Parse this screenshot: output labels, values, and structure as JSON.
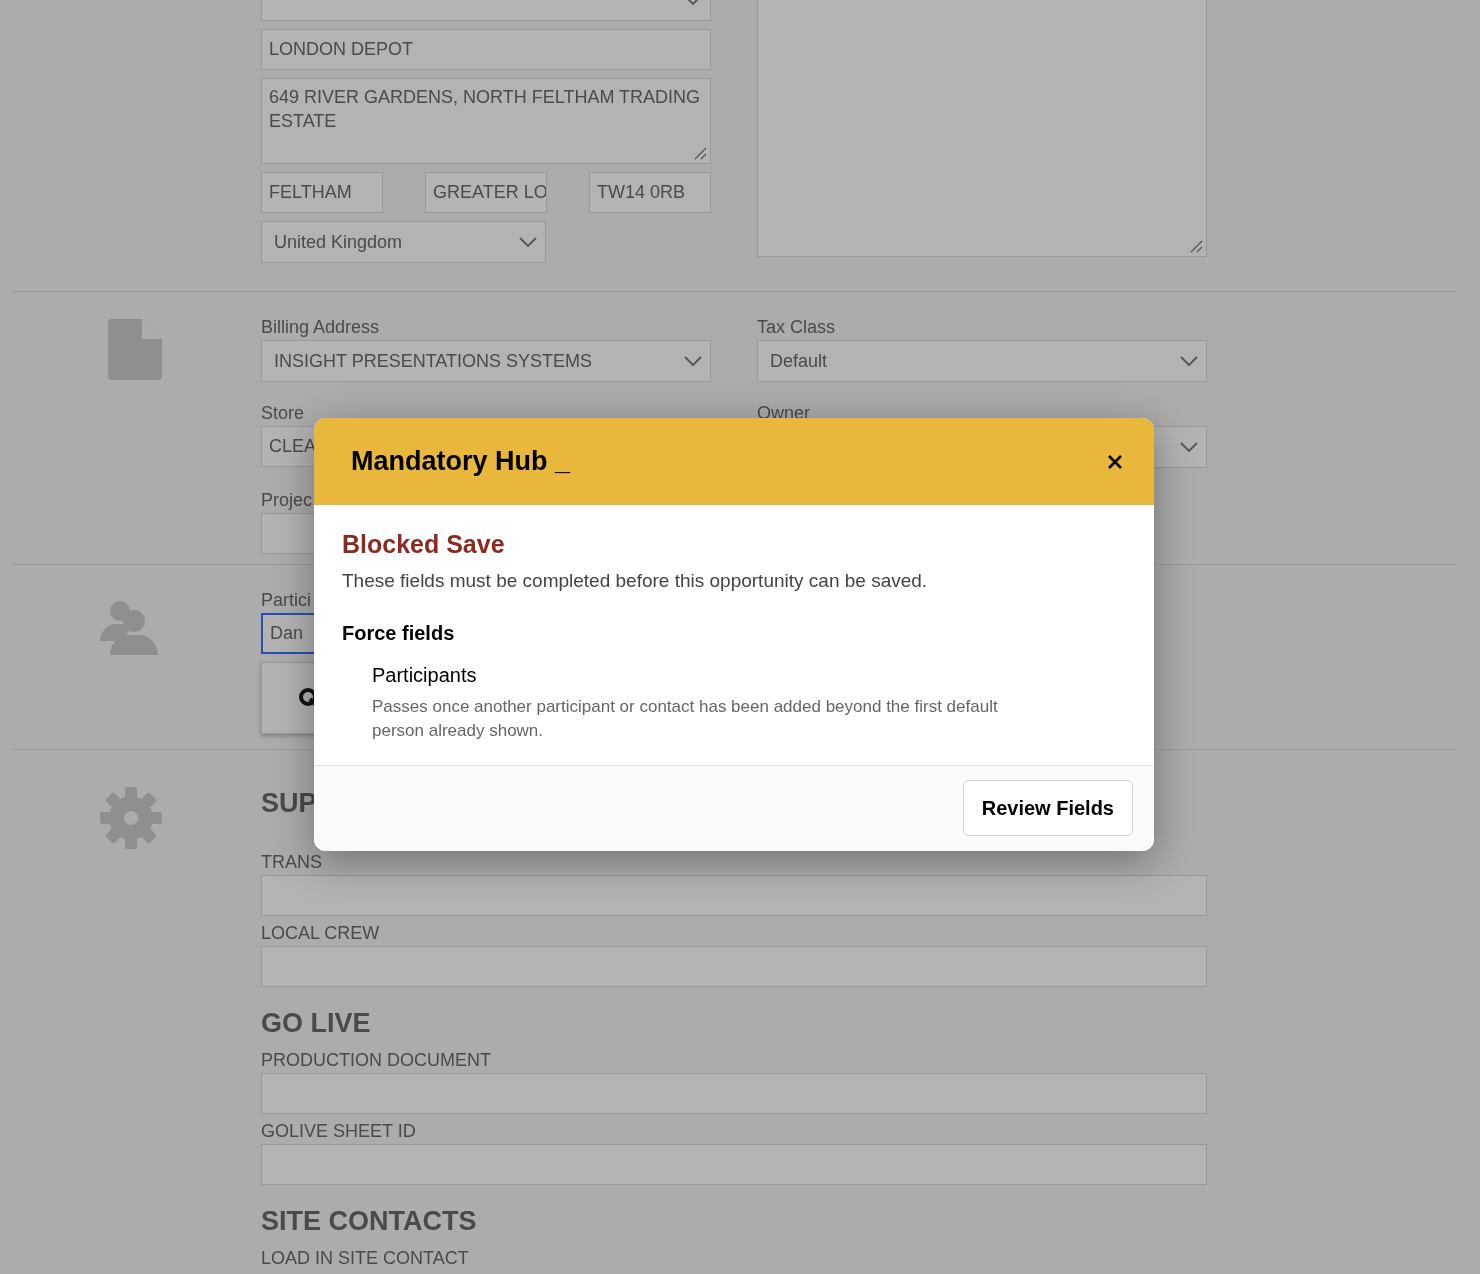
{
  "address": {
    "company": "LONDON DEPOT",
    "street": "649 RIVER GARDENS, NORTH FELTHAM TRADING ESTATE",
    "city": "FELTHAM",
    "county": "GREATER LO",
    "postcode": "TW14 0RB",
    "country": "United Kingdom"
  },
  "billing": {
    "fields": [
      {
        "label": "Billing Address",
        "value": "INSIGHT PRESENTATIONS SYSTEMS",
        "kind": "select"
      },
      {
        "label": "Tax Class",
        "value": "Default",
        "kind": "select"
      },
      {
        "label": "Store",
        "value": "CLEA",
        "kind": "input"
      },
      {
        "label": "Owner",
        "kind": "select"
      },
      {
        "label": "Projec",
        "kind": "input"
      }
    ]
  },
  "participants": {
    "label": "Partici",
    "value": "Dan",
    "focused": true
  },
  "custom_fields": {
    "sections": [
      {
        "heading": "SUP",
        "fields": [
          {
            "label": "TRANS"
          },
          {
            "label": "LOCAL CREW"
          }
        ]
      },
      {
        "heading": "GO LIVE",
        "fields": [
          {
            "label": "PRODUCTION DOCUMENT"
          },
          {
            "label": "GOLIVE SHEET ID"
          }
        ]
      },
      {
        "heading": "SITE CONTACTS",
        "fields": [
          {
            "label": "LOAD IN SITE CONTACT"
          }
        ]
      }
    ]
  },
  "modal": {
    "title": "Mandatory Hub _",
    "heading": "Blocked Save",
    "message": "These fields must be completed before this opportunity can be saved.",
    "group_title": "Force fields",
    "items": [
      {
        "name": "Participants",
        "description": "Passes once another participant or contact has been added beyond the first default person already shown."
      }
    ],
    "buttons": [
      "Review Fields"
    ]
  }
}
